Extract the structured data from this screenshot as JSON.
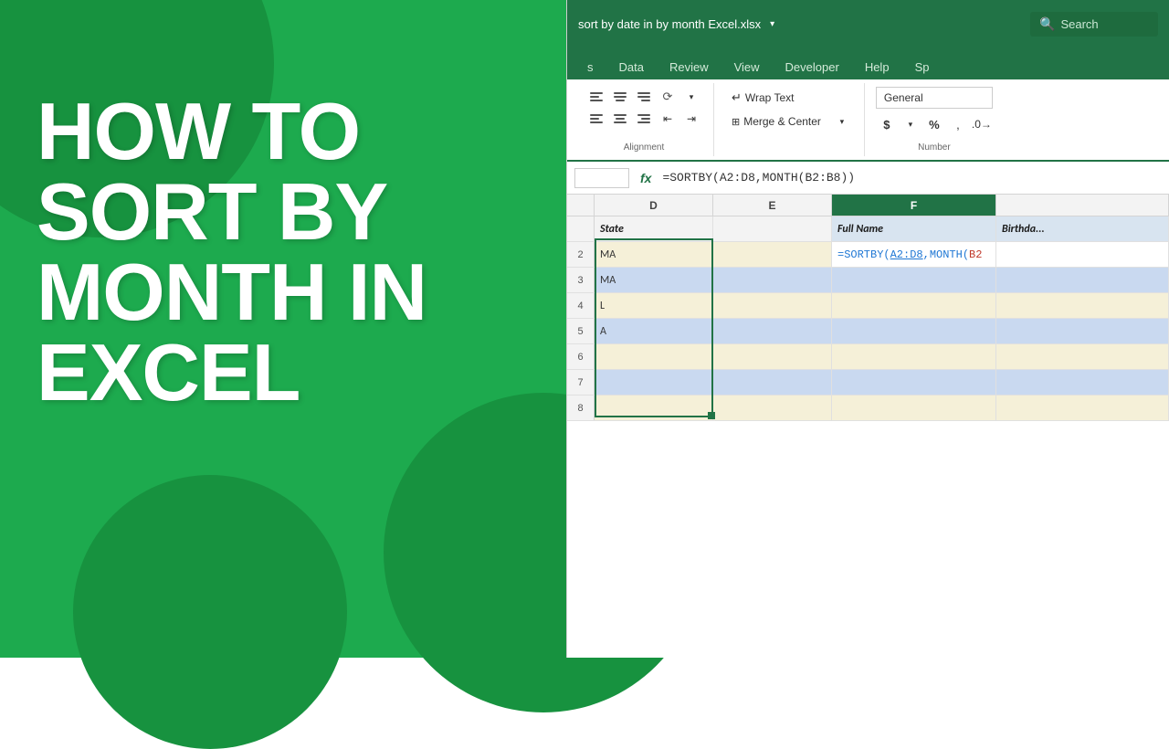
{
  "background": {
    "color": "#1daa4e"
  },
  "title": {
    "line1": "HOW TO",
    "line2": "SORT BY",
    "line3": "MONTH IN",
    "line4": "EXCEL"
  },
  "excel": {
    "title_bar": {
      "filename": "sort by date in by month Excel.xlsx",
      "dropdown_symbol": "▾",
      "search_label": "Search"
    },
    "ribbon": {
      "tabs": [
        "s",
        "Data",
        "Review",
        "View",
        "Developer",
        "Help",
        "Sp"
      ],
      "groups": {
        "alignment": {
          "label": "Alignment",
          "wrap_text": "Wrap Text",
          "merge_center": "Merge & Center"
        },
        "number": {
          "label": "Number",
          "format": "General"
        }
      }
    },
    "formula_bar": {
      "fx": "fx",
      "formula": "=SORTBY(A2:D8,MONTH(B2:B8))"
    },
    "columns": [
      {
        "id": "D",
        "label": "D",
        "width": 130
      },
      {
        "id": "E",
        "label": "E",
        "width": 130
      },
      {
        "id": "F",
        "label": "F",
        "width": 180
      }
    ],
    "col_headers": [
      "D",
      "E",
      "F"
    ],
    "grid": {
      "header_row": {
        "d": "State",
        "e": "",
        "f": "Full Name",
        "g": "Birthda..."
      },
      "rows": [
        {
          "d": "MA",
          "e": "",
          "f": "=SORTBY(A2:D8,MONTH(B2",
          "style": "tan"
        },
        {
          "d": "MA",
          "e": "",
          "f": "",
          "style": "blue"
        },
        {
          "d": "L",
          "e": "",
          "f": "",
          "style": "tan"
        },
        {
          "d": "A",
          "e": "",
          "f": "",
          "style": "blue"
        },
        {
          "d": "",
          "e": "",
          "f": "",
          "style": "tan"
        },
        {
          "d": "",
          "e": "",
          "f": "",
          "style": "blue"
        },
        {
          "d": "",
          "e": "",
          "f": "",
          "style": "tan"
        }
      ]
    }
  }
}
